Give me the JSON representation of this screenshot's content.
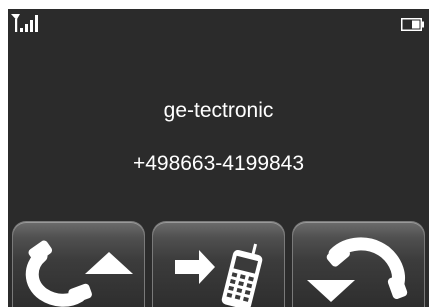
{
  "status": {
    "signal_icon": "signal-strength-icon",
    "battery_icon": "battery-icon"
  },
  "caller": {
    "name": "ge-tectronic",
    "number": "+498663-4199843"
  },
  "actions": {
    "accept_icon": "phone-handset-up-arrow-icon",
    "forward_icon": "arrow-to-mobile-icon",
    "reject_icon": "phone-handset-down-arrow-icon"
  },
  "colors": {
    "screen_background": "#2b2b2b",
    "text": "#ffffff",
    "icon": "#ffffff"
  }
}
